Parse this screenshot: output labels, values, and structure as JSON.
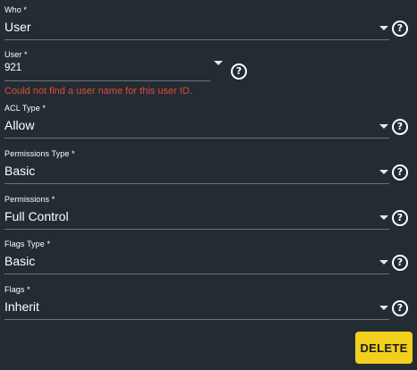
{
  "form": {
    "who": {
      "label": "Who *",
      "value": "User"
    },
    "user": {
      "label": "User *",
      "value": "921",
      "error": "Could not find a user name for this user ID."
    },
    "acl_type": {
      "label": "ACL Type *",
      "value": "Allow"
    },
    "permissions_type": {
      "label": "Permissions Type *",
      "value": "Basic"
    },
    "permissions": {
      "label": "Permissions *",
      "value": "Full Control"
    },
    "flags_type": {
      "label": "Flags Type *",
      "value": "Basic"
    },
    "flags": {
      "label": "Flags *",
      "value": "Inherit"
    },
    "help_glyph": "?",
    "delete_label": "DELETE"
  },
  "colors": {
    "background": "#232b33",
    "error": "#e04a3a",
    "delete_button": "#f2cf1c",
    "underline": "#6b7580"
  },
  "icons": {
    "dropdown": "chevron-down-icon",
    "help": "help-circle-icon"
  }
}
